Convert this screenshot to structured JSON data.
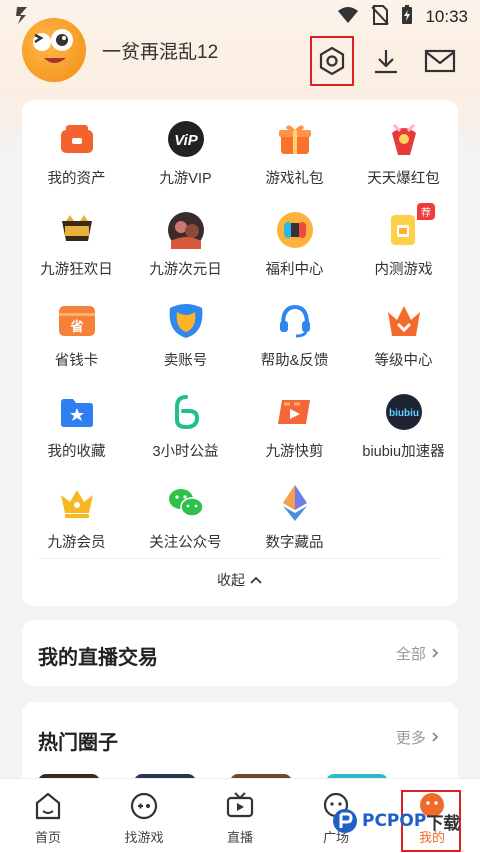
{
  "status_bar": {
    "time": "10:33"
  },
  "profile": {
    "username": "一贫再混乱12"
  },
  "quick_grid": {
    "items": [
      {
        "label": "我的资产",
        "icon": "wallet-icon"
      },
      {
        "label": "九游VIP",
        "icon": "vip-icon"
      },
      {
        "label": "游戏礼包",
        "icon": "gift-icon"
      },
      {
        "label": "天天爆红包",
        "icon": "red-envelope-icon"
      },
      {
        "label": "九游狂欢日",
        "icon": "carnival-icon"
      },
      {
        "label": "九游次元日",
        "icon": "anime-icon"
      },
      {
        "label": "福利中心",
        "icon": "switch-console-icon"
      },
      {
        "label": "内测游戏",
        "icon": "beta-game-icon",
        "badge": "荐"
      },
      {
        "label": "省钱卡",
        "icon": "savings-card-icon"
      },
      {
        "label": "卖账号",
        "icon": "sell-account-icon"
      },
      {
        "label": "帮助&反馈",
        "icon": "headset-icon"
      },
      {
        "label": "等级中心",
        "icon": "level-crown-icon"
      },
      {
        "label": "我的收藏",
        "icon": "favorites-folder-icon"
      },
      {
        "label": "3小时公益",
        "icon": "charity-icon"
      },
      {
        "label": "九游快剪",
        "icon": "video-clip-icon"
      },
      {
        "label": "biubiu加速器",
        "icon": "accelerator-icon"
      },
      {
        "label": "九游会员",
        "icon": "member-crown-icon"
      },
      {
        "label": "关注公众号",
        "icon": "wechat-icon"
      },
      {
        "label": "数字藏品",
        "icon": "ethereum-icon"
      }
    ],
    "collapse_label": "收起"
  },
  "live_trade": {
    "title": "我的直播交易",
    "more": "全部"
  },
  "hot_circles": {
    "title": "热门圈子",
    "more": "更多"
  },
  "tabbar": {
    "tabs": [
      {
        "label": "首页",
        "icon": "home-icon"
      },
      {
        "label": "找游戏",
        "icon": "gamepad-icon"
      },
      {
        "label": "直播",
        "icon": "tv-icon"
      },
      {
        "label": "广场",
        "icon": "plaza-icon"
      },
      {
        "label": "我的",
        "icon": "profile-icon"
      }
    ]
  },
  "watermark": {
    "text_a": "PCPOP",
    "text_b": "下载"
  },
  "colors": {
    "accent": "#f06b2a",
    "highlight_box": "#e02020"
  }
}
